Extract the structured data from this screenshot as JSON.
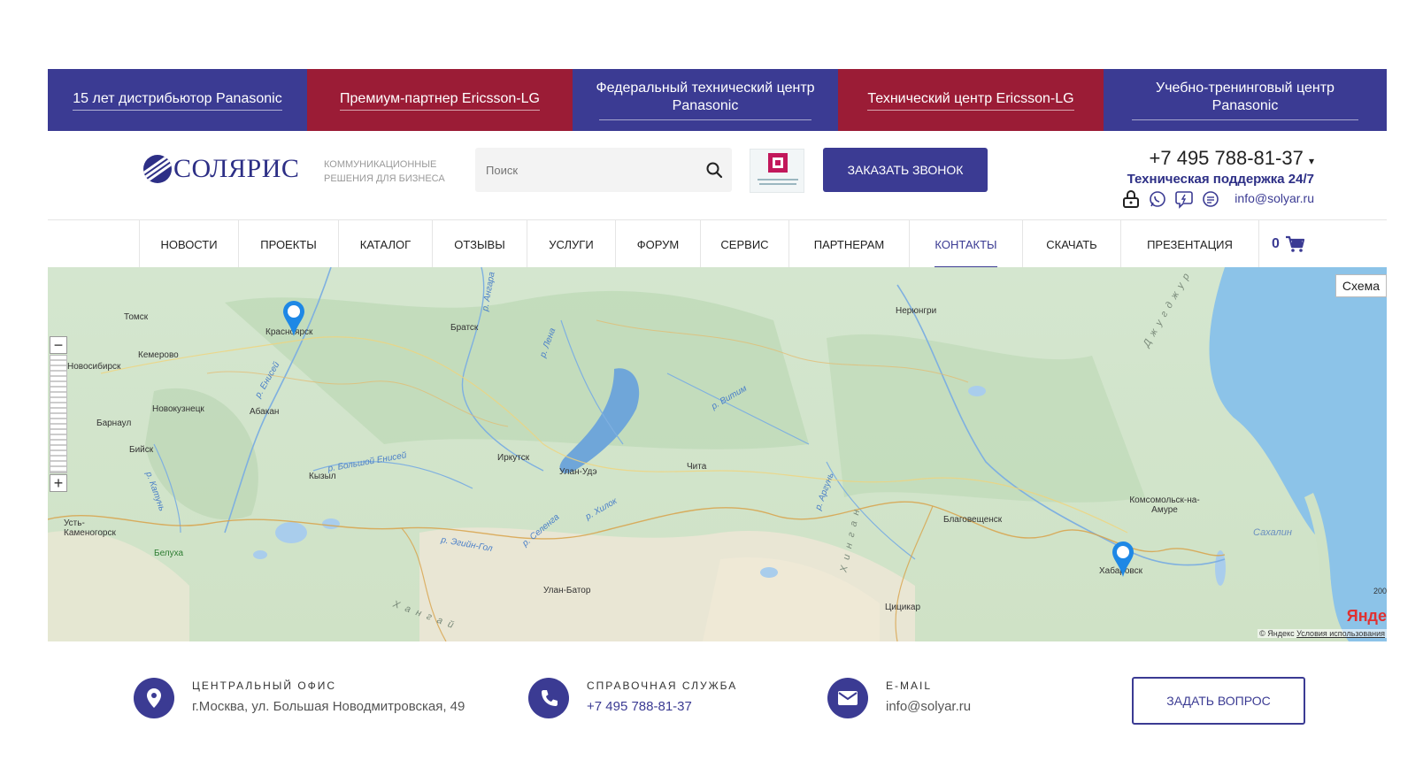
{
  "banner": [
    {
      "label": "15 лет дистрибьютор Panasonic",
      "color": "#3b3b93"
    },
    {
      "label": "Премиум-партнер Ericsson-LG",
      "color": "#9b1c36"
    },
    {
      "label": "Федеральный технический центр Panasonic",
      "color": "#3b3b93"
    },
    {
      "label": "Технический центр Ericsson-LG",
      "color": "#9b1c36"
    },
    {
      "label": "Учебно-тренинговый центр Panasonic",
      "color": "#3b3b93"
    }
  ],
  "header": {
    "logo": "СОЛЯРИС",
    "tagline_1": "КОММУНИКАЦИОННЫЕ",
    "tagline_2": "РЕШЕНИЯ ДЛЯ БИЗНЕСА",
    "search_placeholder": "Поиск",
    "call_button": "ЗАКАЗАТЬ ЗВОНОК",
    "phone": "+7 495 788-81-37",
    "support": "Техническая поддержка  24/7",
    "email": "info@solyar.ru",
    "icons": [
      "lock-icon",
      "whatsapp-icon",
      "viber-icon",
      "chat-icon"
    ]
  },
  "nav": {
    "items": [
      "НОВОСТИ",
      "ПРОЕКТЫ",
      "КАТАЛОГ",
      "ОТЗЫВЫ",
      "УСЛУГИ",
      "ФОРУМ",
      "СЕРВИС",
      "ПАРТНЕРАМ",
      "КОНТАКТЫ",
      "СКАЧАТЬ",
      "ПРЕЗЕНТАЦИЯ"
    ],
    "active": "КОНТАКТЫ",
    "cart_count": "0"
  },
  "map": {
    "type_button": "Схема",
    "copyright": "© Яндекс",
    "terms": "Условия использования",
    "scale": "200",
    "logo": "Янде",
    "cities": [
      "Томск",
      "Красноярск",
      "Кемерово",
      "Новосибирск",
      "Новокузнецк",
      "Абакан",
      "Барнаул",
      "Бийск",
      "Кызыл",
      "Усть-Каменогорск",
      "Белуха",
      "Братск",
      "Иркутск",
      "Улан-Удэ",
      "Чита",
      "Улан-Батор",
      "Нерюнгри",
      "Благовещенск",
      "Комсомольск-на-Амуре",
      "Хабаровск",
      "Цицикар"
    ],
    "rivers": [
      "р. Ангара",
      "р. Лена",
      "р. Енисей",
      "р. Витим",
      "р. Большой Енисей",
      "р. Катунь",
      "р. Селенга",
      "р. Хилок",
      "р. Аргунь",
      "р. Эгийн-Гол"
    ],
    "regions": [
      "Сахалин",
      "Джугджур",
      "Хинган",
      "Хангай"
    ],
    "markers": [
      "Красноярск",
      "Хабаровск"
    ]
  },
  "contacts": {
    "office_label": "ЦЕНТРАЛЬНЫЙ ОФИС",
    "office_value": "г.Москва, ул. Большая Новодмитровская, 49",
    "help_label": "СПРАВОЧНАЯ СЛУЖБА",
    "help_value": "+7 495 788-81-37",
    "email_label": "E-MAIL",
    "email_value": "info@solyar.ru",
    "ask_button": "ЗАДАТЬ ВОПРОС"
  }
}
